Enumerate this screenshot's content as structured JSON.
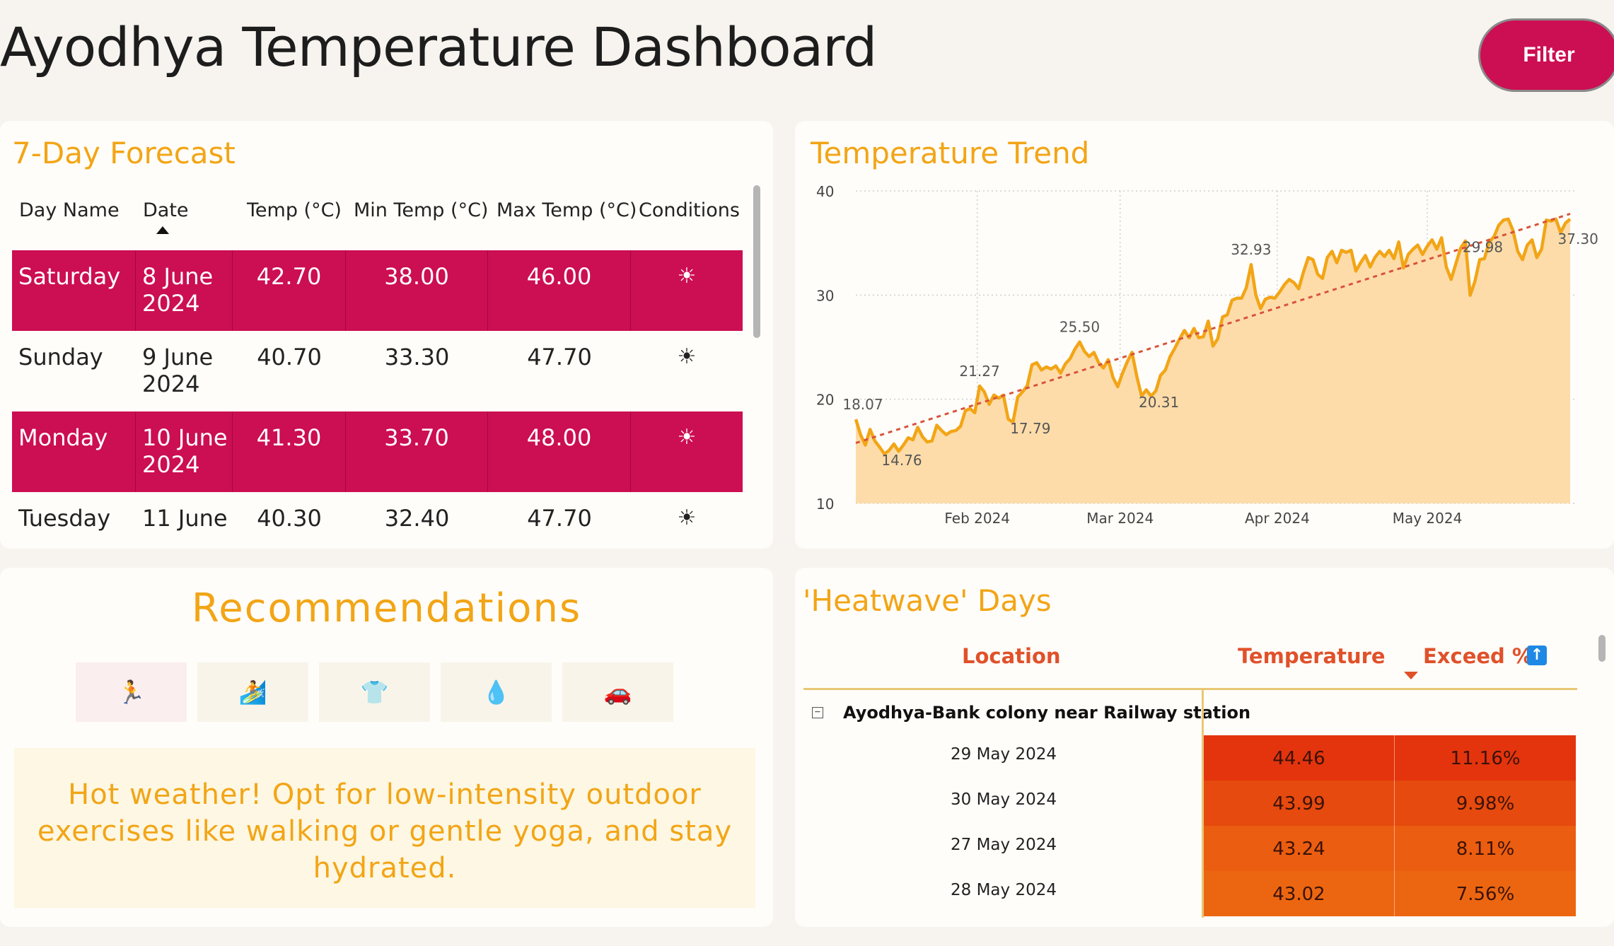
{
  "header": {
    "title": "Ayodhya Temperature Dashboard",
    "filter_label": "Filter"
  },
  "forecast": {
    "title": "7-Day Forecast",
    "columns": [
      "Day Name",
      "Date",
      "Temp (°C)",
      "Min Temp (°C)",
      "Max Temp (°C)",
      "Conditions"
    ],
    "rows": [
      {
        "day": "Saturday",
        "date": "8 June 2024",
        "temp": "42.70",
        "min": "38.00",
        "max": "46.00",
        "cond": "☀",
        "highlight": true
      },
      {
        "day": "Sunday",
        "date": "9 June 2024",
        "temp": "40.70",
        "min": "33.30",
        "max": "47.70",
        "cond": "☀",
        "highlight": false
      },
      {
        "day": "Monday",
        "date": "10 June 2024",
        "temp": "41.30",
        "min": "33.70",
        "max": "48.00",
        "cond": "☀",
        "highlight": true
      },
      {
        "day": "Tuesday",
        "date": "11 June",
        "temp": "40.30",
        "min": "32.40",
        "max": "47.70",
        "cond": "☀",
        "highlight": false
      }
    ]
  },
  "trend": {
    "title": "Temperature Trend",
    "chart_data": {
      "type": "area",
      "x_labels": [
        "Feb 2024",
        "Mar 2024",
        "Apr 2024",
        "May 2024"
      ],
      "yticks": [
        "10",
        "20",
        "30",
        "40"
      ],
      "ylim": [
        10,
        40
      ],
      "series_values": [
        18.07,
        16.6,
        15.6,
        17.1,
        16.0,
        15.4,
        14.76,
        15.1,
        15.7,
        15.0,
        15.6,
        16.3,
        16.1,
        17.3,
        16.4,
        15.9,
        16.0,
        17.5,
        17.0,
        16.6,
        16.9,
        17.0,
        17.4,
        18.9,
        19.1,
        18.7,
        21.27,
        20.7,
        19.5,
        20.4,
        20.1,
        20.4,
        18.1,
        17.79,
        20.2,
        20.7,
        21.3,
        23.3,
        23.5,
        22.8,
        23.1,
        22.9,
        23.2,
        22.5,
        23.4,
        23.9,
        24.8,
        25.5,
        24.6,
        24.1,
        24.5,
        23.5,
        23.0,
        23.8,
        22.1,
        21.2,
        22.5,
        23.6,
        24.5,
        22.2,
        20.31,
        20.9,
        20.3,
        20.8,
        22.3,
        22.8,
        24.1,
        24.9,
        25.8,
        26.6,
        25.9,
        26.8,
        25.9,
        26.0,
        27.5,
        25.1,
        25.8,
        27.9,
        28.1,
        29.5,
        29.7,
        29.7,
        30.7,
        32.93,
        30.0,
        28.7,
        29.6,
        29.8,
        29.7,
        30.3,
        31.0,
        31.5,
        31.2,
        30.6,
        32.2,
        33.6,
        33.4,
        32.0,
        31.6,
        33.6,
        34.2,
        33.1,
        34.3,
        34.1,
        34.3,
        32.3,
        33.1,
        33.8,
        32.7,
        33.6,
        34.2,
        33.7,
        34.3,
        33.5,
        35.1,
        32.6,
        33.9,
        34.4,
        34.8,
        33.9,
        34.7,
        35.3,
        34.4,
        35.5,
        32.7,
        31.5,
        33.0,
        34.5,
        35.2,
        29.98,
        31.3,
        33.4,
        33.5,
        35.1,
        35.6,
        36.7,
        37.2,
        37.3,
        36.2,
        34.2,
        33.4,
        34.8,
        35.3,
        33.6,
        34.4,
        37.2,
        37.1,
        37.3,
        36.0,
        36.9,
        37.3
      ],
      "trend_line": [
        15.8,
        37.8
      ],
      "data_labels": [
        {
          "index": 0,
          "text": "18.07",
          "pos": "above"
        },
        {
          "index": 6,
          "text": "14.76",
          "pos": "right"
        },
        {
          "index": 26,
          "text": "21.27",
          "pos": "above"
        },
        {
          "index": 33,
          "text": "17.79",
          "pos": "right"
        },
        {
          "index": 47,
          "text": "25.50",
          "pos": "above"
        },
        {
          "index": 60,
          "text": "20.31",
          "pos": "right"
        },
        {
          "index": 83,
          "text": "32.93",
          "pos": "above"
        },
        {
          "index": 128,
          "text": "29.98",
          "pos": "right"
        },
        {
          "index": 148,
          "text": "37.30",
          "pos": "right"
        }
      ],
      "label_positions": [
        0.17,
        0.37,
        0.59,
        0.8
      ],
      "grid": true,
      "fill_color": "#fddcaa",
      "line_color": "#f2a516",
      "trend_color": "#d9533a"
    }
  },
  "recommendations": {
    "title": "Recommendations",
    "tiles": [
      {
        "icon": "🏃",
        "name": "running-icon",
        "selected": true
      },
      {
        "icon": "🏄",
        "name": "surfing-icon",
        "selected": false
      },
      {
        "icon": "👕",
        "name": "tshirt-icon",
        "selected": false
      },
      {
        "icon": "💧",
        "name": "water-drop-icon",
        "selected": false
      },
      {
        "icon": "🚗",
        "name": "car-icon",
        "selected": false
      }
    ],
    "text": "Hot weather! Opt for low-intensity outdoor exercises like walking or gentle yoga, and stay hydrated."
  },
  "heatwave": {
    "title": "'Heatwave' Days",
    "col_location": "Location",
    "col_temperature": "Temperature",
    "col_exceed": "Exceed %",
    "group_label": "Ayodhya-Bank colony near Railway station",
    "expand_symbol": "−",
    "rows": [
      {
        "date": "29 May 2024",
        "temp": "44.46",
        "exceed": "11.16%",
        "color": "#e3340d"
      },
      {
        "date": "30 May 2024",
        "temp": "43.99",
        "exceed": "9.98%",
        "color": "#e64a0e"
      },
      {
        "date": "27 May 2024",
        "temp": "43.24",
        "exceed": "8.11%",
        "color": "#eb5d10"
      },
      {
        "date": "28 May 2024",
        "temp": "43.02",
        "exceed": "7.56%",
        "color": "#ec6611"
      }
    ]
  }
}
